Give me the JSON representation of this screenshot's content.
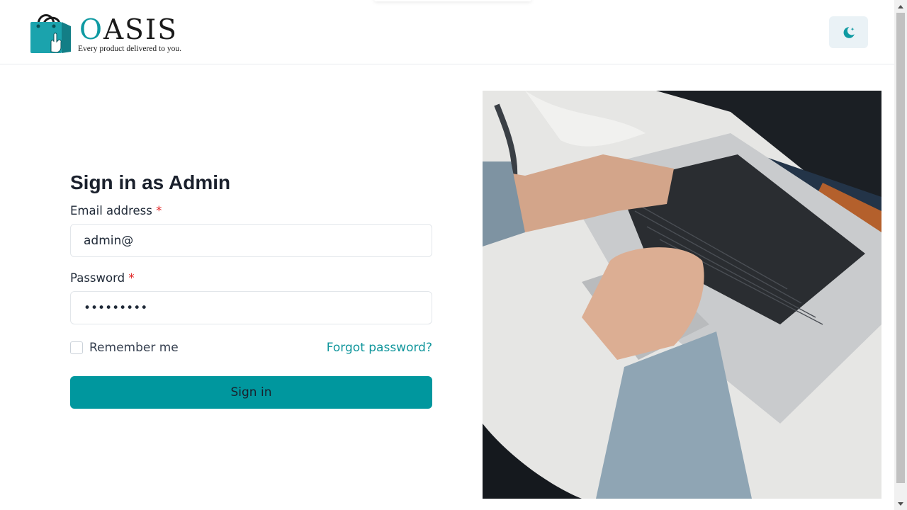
{
  "brand": {
    "name_first": "O",
    "name_rest": "ASIS",
    "tagline": "Every product delivered to you."
  },
  "header": {
    "theme_toggle_icon": "moon-star-icon"
  },
  "form": {
    "title": "Sign in as Admin",
    "email_label": "Email address",
    "email_value": "admin@",
    "password_label": "Password",
    "password_value": "•••••••••",
    "required_mark": "*",
    "remember_label": "Remember me",
    "forgot_label": "Forgot password?",
    "submit_label": "Sign in"
  },
  "colors": {
    "accent": "#00979e",
    "link": "#11969c",
    "required": "#e02424",
    "theme_button_bg": "#eaf2f6"
  }
}
